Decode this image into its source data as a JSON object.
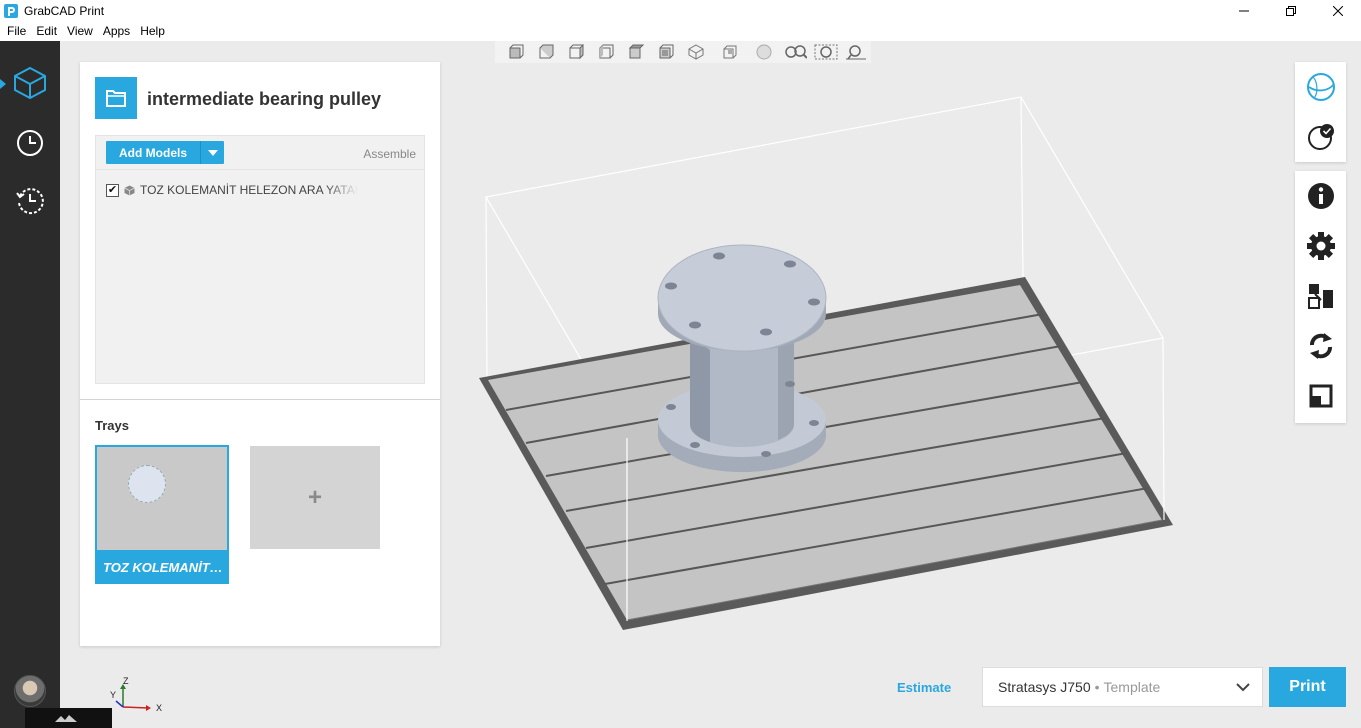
{
  "window": {
    "title": "GrabCAD Print",
    "controls": [
      "minimize-icon",
      "restore-icon",
      "close-icon"
    ]
  },
  "menu": {
    "items": [
      "File",
      "Edit",
      "View",
      "Apps",
      "Help"
    ]
  },
  "rail": {
    "items": [
      {
        "name": "models",
        "icon": "cube-icon",
        "active": true
      },
      {
        "name": "history",
        "icon": "clock-icon"
      },
      {
        "name": "recent",
        "icon": "history-icon"
      }
    ]
  },
  "project": {
    "title": "intermediate bearing pulley",
    "add_models_label": "Add Models",
    "assemble_label": "Assemble",
    "models": [
      {
        "name": "TOZ KOLEMANİT HELEZON ARA YATAK",
        "checked": true
      }
    ]
  },
  "trays": {
    "label": "Trays",
    "items": [
      {
        "name": "TOZ KOLEMANİT HELEZON ARA YATAK",
        "selected": true
      }
    ],
    "add_label": "+"
  },
  "view_toolbar": {
    "icons": [
      "view-front-icon",
      "view-back-icon",
      "view-left-icon",
      "view-right-icon",
      "view-top-icon",
      "view-bottom-icon",
      "view-iso-icon",
      "view-fit-icon",
      "sphere-shading-icon",
      "zoom-icon",
      "zoom-selection-icon",
      "zoom-fit-icon"
    ]
  },
  "right_tools": {
    "group_a": [
      "globe-icon",
      "check-status-icon"
    ],
    "group_b": [
      "info-icon",
      "gear-icon",
      "arrange-icon",
      "rotate-icon",
      "scale-icon"
    ]
  },
  "bottom": {
    "estimate_label": "Estimate",
    "printer_name": "Stratasys J750",
    "printer_separator": "•",
    "printer_mode": "Template",
    "print_label": "Print"
  },
  "axes": {
    "x": "X",
    "y": "Y",
    "z": "Z"
  },
  "colors": {
    "accent": "#29a8e0",
    "rail": "#2b2b2b",
    "tray": "#c9c9c9",
    "part": "#b7bfcc"
  }
}
